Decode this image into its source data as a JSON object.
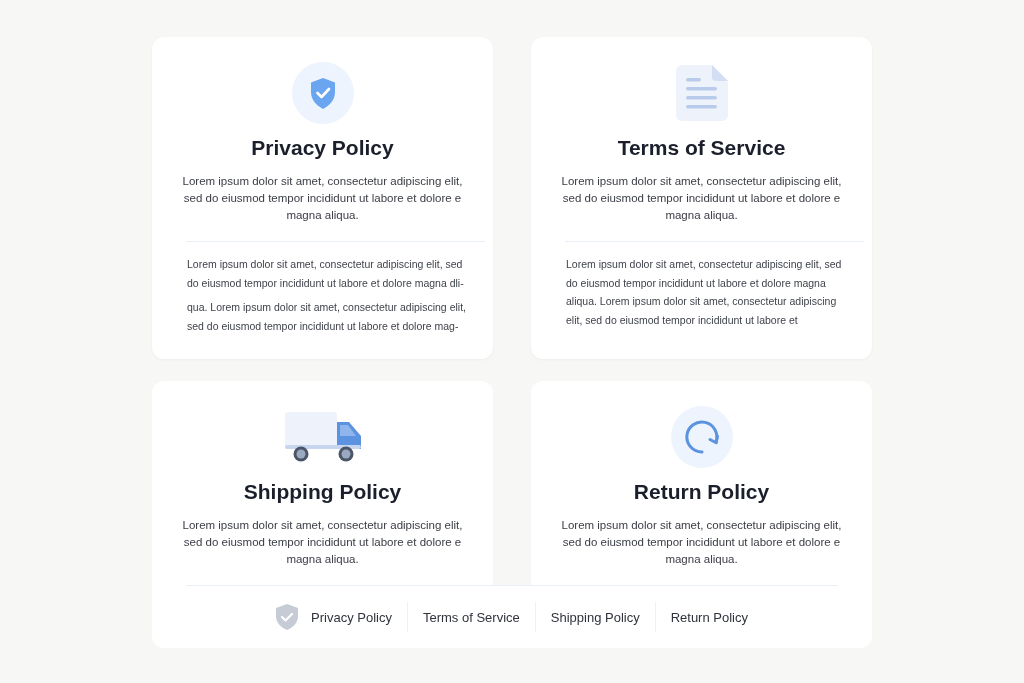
{
  "cards": [
    {
      "title": "Privacy Policy",
      "summary": "Lorem ipsum dolor sit amet, consectetur adipiscing elit,\nsed do eiusmod tempor incididunt ut labore et dolore e\nmagna aliqua.",
      "body": [
        "Lorem ipsum dolor sit amet, consectetur adipiscing elit, sed\ndo eiusmod tempor incididunt ut labore et dolore magna dli-",
        "qua. Lorem ipsum dolor sit amet, consectetur adipiscing elit,\nsed do eiusmod tempor incididunt ut labore et dolore mag-"
      ]
    },
    {
      "title": "Terms of Service",
      "summary": "Lorem ipsum dolor sit amet, consectetur adipiscing elit,\nsed do eiusmod tempor incididunt ut labore et dolore e\nmagna aliqua.",
      "body": [
        "Lorem ipsum dolor sit amet, consectetur adipiscing elit, sed\ndo eiusmod tempor incididunt ut labore et dolore magna\naliqua. Lorem ipsum dolor sit amet, consectetur adipiscing\nelit, sed do eiusmod tempor incididunt ut labore et"
      ]
    },
    {
      "title": "Shipping Policy",
      "summary": "Lorem ipsum dolor sit amet, consectetur adipiscing elit,\nsed do eiusmod tempor incididunt ut labore et dolore e\nmagna aliqua."
    },
    {
      "title": "Return Policy",
      "summary": "Lorem ipsum dolor sit amet, consectetur adipiscing elit,\nsed do eiusmod tempor incididunt ut labore et dolore e\nmagna aliqua."
    }
  ],
  "footer": {
    "links": [
      {
        "label": "Privacy Policy"
      },
      {
        "label": "Terms of Service"
      },
      {
        "label": "Shipping Policy"
      },
      {
        "label": "Return Policy"
      }
    ]
  }
}
